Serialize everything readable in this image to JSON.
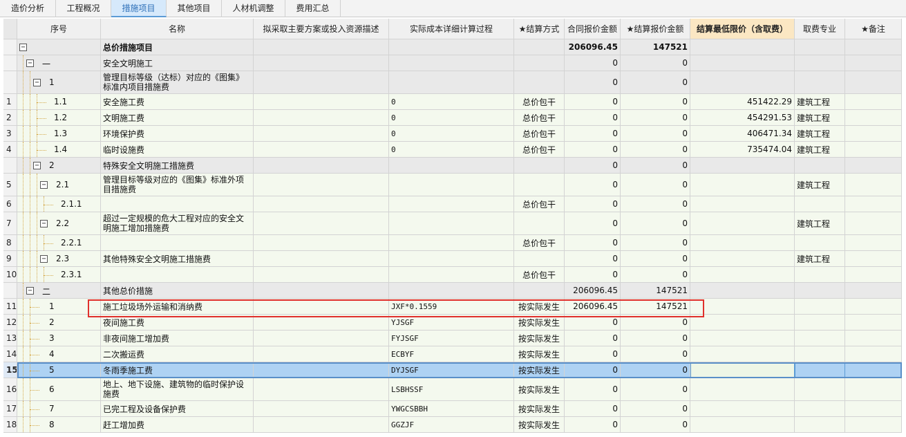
{
  "tabs": [
    "造价分析",
    "工程概况",
    "措施项目",
    "其他项目",
    "人材机调整",
    "费用汇总"
  ],
  "active_tab": "措施项目",
  "columns": {
    "seq": "序号",
    "name": "名称",
    "plan": "拟采取主要方案或投入资源描述",
    "calc": "实际成本详细计算过程",
    "method": "★结算方式",
    "contract": "合同报价金额",
    "settle": "★结算报价金额",
    "limit": "结算最低限价（含取费）",
    "major": "取费专业",
    "remark": "★备注"
  },
  "rows": [
    {
      "n": "",
      "seq": "",
      "name": "总价措施项目",
      "plan": "",
      "calc": "",
      "method": "",
      "contract": "206096.45",
      "settle": "147521",
      "limit": "",
      "major": "",
      "type": "group"
    },
    {
      "n": "",
      "seq": "一",
      "name": "安全文明施工",
      "plan": "",
      "calc": "",
      "method": "",
      "contract": "0",
      "settle": "0",
      "limit": "",
      "major": "",
      "type": "group"
    },
    {
      "n": "",
      "seq": "1",
      "name": "管理目标等级（达标）对应的《图集》标准内项目措施费",
      "plan": "",
      "calc": "",
      "method": "",
      "contract": "0",
      "settle": "0",
      "limit": "",
      "major": "",
      "type": "group"
    },
    {
      "n": "1",
      "seq": "1.1",
      "name": "安全施工费",
      "plan": "",
      "calc": "0",
      "method": "总价包干",
      "contract": "0",
      "settle": "0",
      "limit": "451422.29",
      "major": "建筑工程",
      "type": "data"
    },
    {
      "n": "2",
      "seq": "1.2",
      "name": "文明施工费",
      "plan": "",
      "calc": "0",
      "method": "总价包干",
      "contract": "0",
      "settle": "0",
      "limit": "454291.53",
      "major": "建筑工程",
      "type": "data"
    },
    {
      "n": "3",
      "seq": "1.3",
      "name": "环境保护费",
      "plan": "",
      "calc": "0",
      "method": "总价包干",
      "contract": "0",
      "settle": "0",
      "limit": "406471.34",
      "major": "建筑工程",
      "type": "data"
    },
    {
      "n": "4",
      "seq": "1.4",
      "name": "临时设施费",
      "plan": "",
      "calc": "0",
      "method": "总价包干",
      "contract": "0",
      "settle": "0",
      "limit": "735474.04",
      "major": "建筑工程",
      "type": "data"
    },
    {
      "n": "",
      "seq": "2",
      "name": "特殊安全文明施工措施费",
      "plan": "",
      "calc": "",
      "method": "",
      "contract": "0",
      "settle": "0",
      "limit": "",
      "major": "",
      "type": "group"
    },
    {
      "n": "5",
      "seq": "2.1",
      "name": "管理目标等级对应的《图集》标准外项目措施费",
      "plan": "",
      "calc": "",
      "method": "",
      "contract": "0",
      "settle": "0",
      "limit": "",
      "major": "建筑工程",
      "type": "data"
    },
    {
      "n": "6",
      "seq": "2.1.1",
      "name": "",
      "plan": "",
      "calc": "",
      "method": "总价包干",
      "contract": "0",
      "settle": "0",
      "limit": "",
      "major": "",
      "type": "data"
    },
    {
      "n": "7",
      "seq": "2.2",
      "name": "超过一定规模的危大工程对应的安全文明施工增加措施费",
      "plan": "",
      "calc": "",
      "method": "",
      "contract": "0",
      "settle": "0",
      "limit": "",
      "major": "建筑工程",
      "type": "data"
    },
    {
      "n": "8",
      "seq": "2.2.1",
      "name": "",
      "plan": "",
      "calc": "",
      "method": "总价包干",
      "contract": "0",
      "settle": "0",
      "limit": "",
      "major": "",
      "type": "data"
    },
    {
      "n": "9",
      "seq": "2.3",
      "name": "其他特殊安全文明施工措施费",
      "plan": "",
      "calc": "",
      "method": "",
      "contract": "0",
      "settle": "0",
      "limit": "",
      "major": "建筑工程",
      "type": "data"
    },
    {
      "n": "10",
      "seq": "2.3.1",
      "name": "",
      "plan": "",
      "calc": "",
      "method": "总价包干",
      "contract": "0",
      "settle": "0",
      "limit": "",
      "major": "",
      "type": "data"
    },
    {
      "n": "",
      "seq": "二",
      "name": "其他总价措施",
      "plan": "",
      "calc": "",
      "method": "",
      "contract": "206096.45",
      "settle": "147521",
      "limit": "",
      "major": "",
      "type": "group"
    },
    {
      "n": "11",
      "seq": "1",
      "name": "施工垃圾场外运输和消纳费",
      "plan": "",
      "calc": "JXF*0.1559",
      "method": "按实际发生",
      "contract": "206096.45",
      "settle": "147521",
      "limit": "",
      "major": "",
      "type": "data"
    },
    {
      "n": "12",
      "seq": "2",
      "name": "夜间施工费",
      "plan": "",
      "calc": "YJSGF",
      "method": "按实际发生",
      "contract": "0",
      "settle": "0",
      "limit": "",
      "major": "",
      "type": "data"
    },
    {
      "n": "13",
      "seq": "3",
      "name": "非夜间施工增加费",
      "plan": "",
      "calc": "FYJSGF",
      "method": "按实际发生",
      "contract": "0",
      "settle": "0",
      "limit": "",
      "major": "",
      "type": "data"
    },
    {
      "n": "14",
      "seq": "4",
      "name": "二次搬运费",
      "plan": "",
      "calc": "ECBYF",
      "method": "按实际发生",
      "contract": "0",
      "settle": "0",
      "limit": "",
      "major": "",
      "type": "data"
    },
    {
      "n": "15",
      "seq": "5",
      "name": "冬雨季施工费",
      "plan": "",
      "calc": "DYJSGF",
      "method": "按实际发生",
      "contract": "0",
      "settle": "0",
      "limit": "",
      "major": "",
      "type": "selected"
    },
    {
      "n": "16",
      "seq": "6",
      "name": "地上、地下设施、建筑物的临时保护设施费",
      "plan": "",
      "calc": "LSBHSSF",
      "method": "按实际发生",
      "contract": "0",
      "settle": "0",
      "limit": "",
      "major": "",
      "type": "data"
    },
    {
      "n": "17",
      "seq": "7",
      "name": "已完工程及设备保护费",
      "plan": "",
      "calc": "YWGCSBBH",
      "method": "按实际发生",
      "contract": "0",
      "settle": "0",
      "limit": "",
      "major": "",
      "type": "data"
    },
    {
      "n": "18",
      "seq": "8",
      "name": "赶工增加费",
      "plan": "",
      "calc": "GGZJF",
      "method": "按实际发生",
      "contract": "0",
      "settle": "0",
      "limit": "",
      "major": "",
      "type": "data"
    }
  ]
}
